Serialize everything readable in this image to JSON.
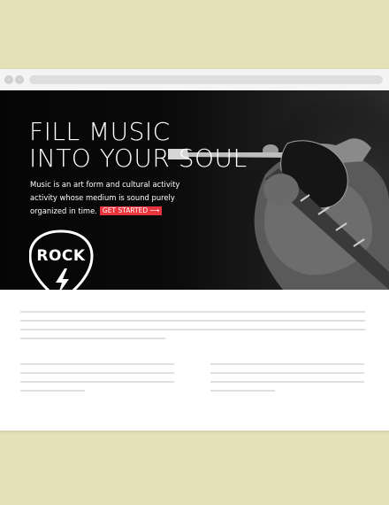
{
  "hero": {
    "headline_line1": "FILL MUSIC",
    "headline_line2": "INTO YOUR SOUL",
    "body": "Music is an art form and cultural activity activity whose medium is sound purely organized in time.",
    "cta_label": "GET STARTED",
    "cta_arrow": "⟶",
    "badge_text": "ROCK"
  },
  "browser": {
    "back_glyph": "‹",
    "forward_glyph": "›"
  },
  "colors": {
    "background": "#e4e0b8",
    "hero_bg": "#0b0b0b",
    "accent": "#e8343c",
    "placeholder_line": "#e0e0e0"
  },
  "icons": [
    "back-icon",
    "forward-icon",
    "guitar-pick-icon",
    "lightning-bolt-icon"
  ]
}
